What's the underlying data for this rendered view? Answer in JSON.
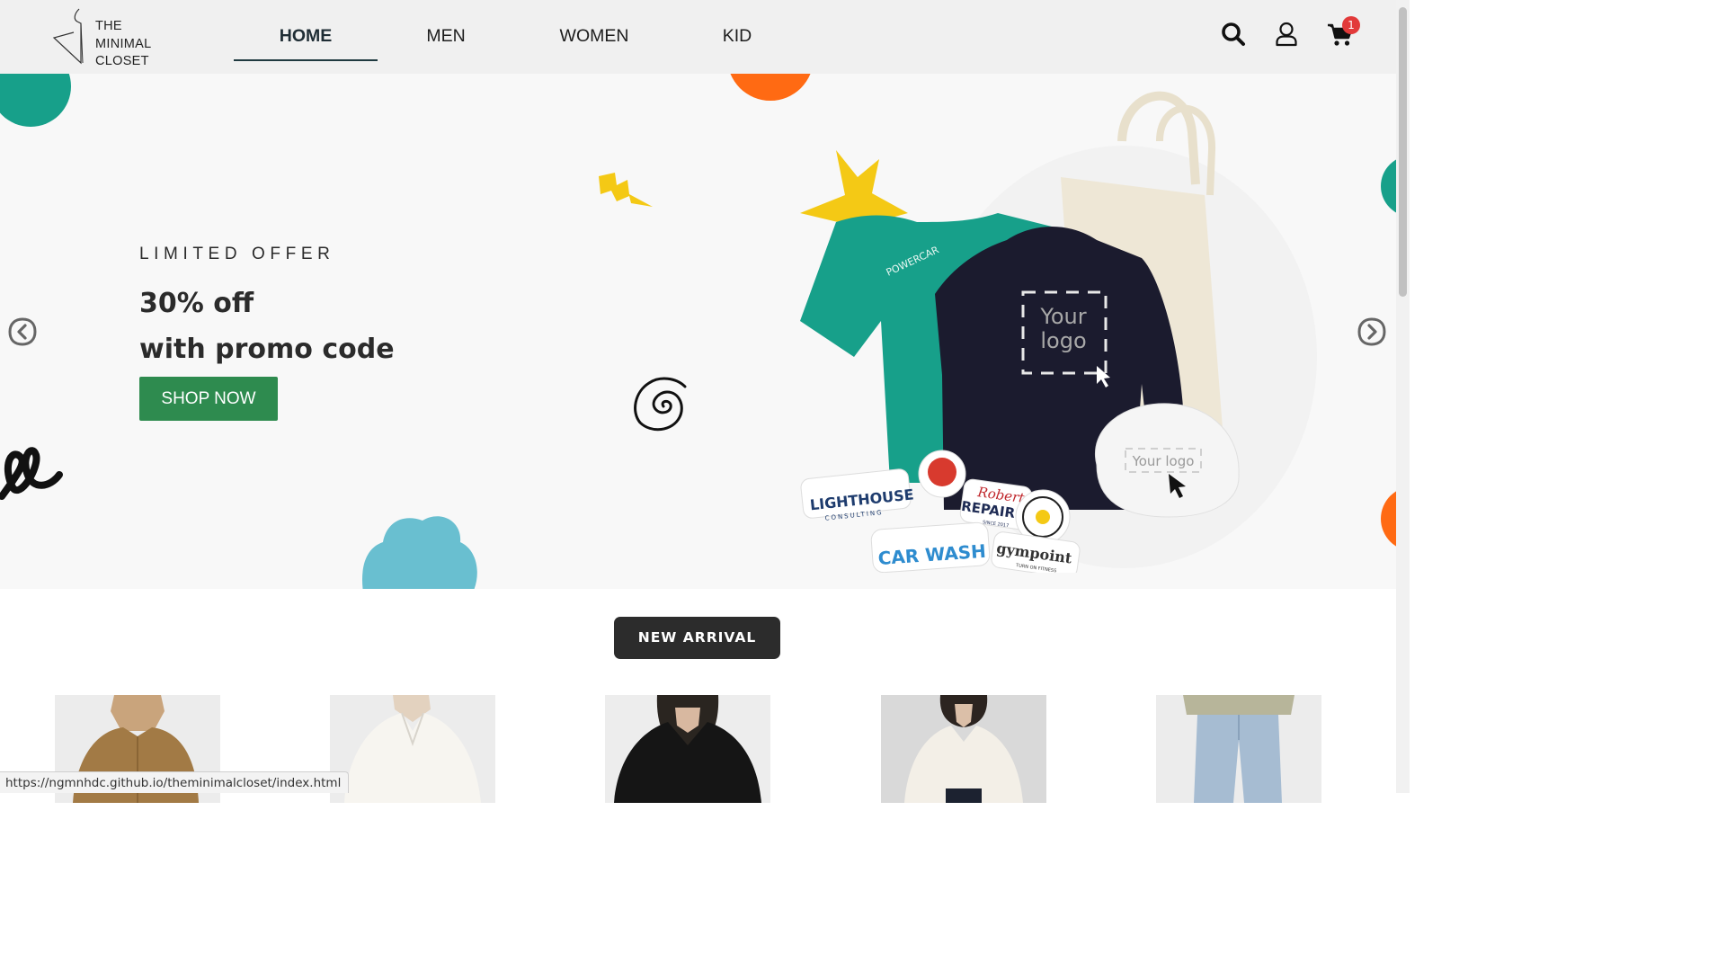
{
  "brand": {
    "line1": "THE",
    "line2": "MINIMAL",
    "line3": "CLOSET"
  },
  "nav": [
    {
      "label": "HOME",
      "active": true
    },
    {
      "label": "MEN",
      "active": false
    },
    {
      "label": "WOMEN",
      "active": false
    },
    {
      "label": "KID",
      "active": false
    }
  ],
  "header_icons": {
    "search": "search-icon",
    "account": "user-icon",
    "cart": "cart-icon",
    "cart_count": "1"
  },
  "hero": {
    "eyebrow": "LIMITED OFFER",
    "headline_line1": "30% off",
    "headline_line2": "with promo code",
    "cta": "SHOP NOW",
    "prev": "chevron-left-icon",
    "next": "chevron-right-icon",
    "image": {
      "tshirt_text": "POWERCAR",
      "sweater_text_line1": "Your",
      "sweater_text_line2": "logo",
      "cap_text": "Your logo",
      "sticker_lighthouse": "LIGHTHOUSE",
      "sticker_lighthouse_sub": "CONSULTING",
      "sticker_repair_line1": "Robert",
      "sticker_repair_line2": "REPAIRMA",
      "sticker_repair_since": "SINCE 2017",
      "sticker_carwash": "CAR WASH",
      "sticker_gym": "gympoint",
      "sticker_gym_sub": "TURN ON FITNESS"
    }
  },
  "section": {
    "new_arrival": "NEW ARRIVAL"
  },
  "products": [
    {
      "name": "product-mustard-shirt"
    },
    {
      "name": "product-white-shirt"
    },
    {
      "name": "product-black-blouse"
    },
    {
      "name": "product-cream-blouse"
    },
    {
      "name": "product-light-jeans"
    }
  ],
  "status_bar": {
    "url": "https://ngmnhdc.github.io/theminimalcloset/index.html"
  },
  "colors": {
    "accent": "#2e8b4f",
    "badge": "#e23a3a",
    "dark_button": "#2c2c2c",
    "teal": "#17a08a",
    "orange": "#ff6a13",
    "cloud": "#69bfd0"
  }
}
